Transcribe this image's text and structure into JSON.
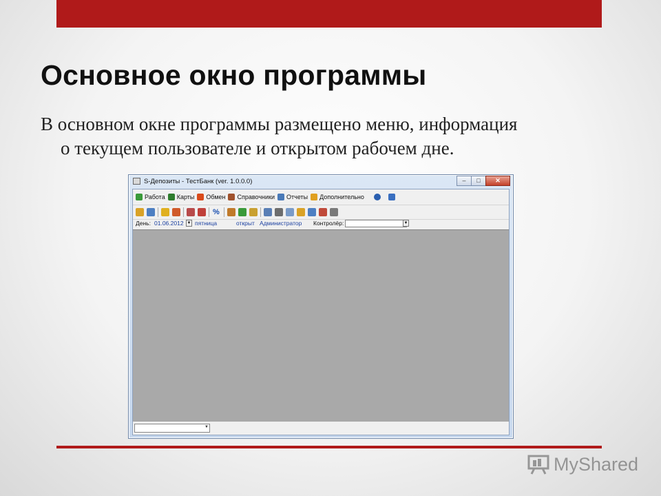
{
  "slide": {
    "title": "Основное окно программы",
    "body_line1": "В основном окне программы размещено меню, информация",
    "body_line2": "о текущем пользователе и открытом рабочем дне."
  },
  "colors": {
    "accent": "#b01a1a",
    "workspace": "#a9a9a9"
  },
  "window": {
    "title": "S-Депозиты - ТестБанк (ver. 1.0.0.0)",
    "menu": [
      {
        "label": "Работа",
        "icon": "work-icon",
        "color": "#3a9a3a"
      },
      {
        "label": "Карты",
        "icon": "cards-icon",
        "color": "#2e7d2e"
      },
      {
        "label": "Обмен",
        "icon": "exchange-icon",
        "color": "#d94a1a"
      },
      {
        "label": "Справочники",
        "icon": "books-icon",
        "color": "#a0522d"
      },
      {
        "label": "Отчеты",
        "icon": "reports-icon",
        "color": "#4a7ab8"
      },
      {
        "label": "Дополнительно",
        "icon": "extra-icon",
        "color": "#e0a020"
      }
    ],
    "toolbar_pct": "%",
    "day": {
      "label": "День:",
      "date": "01.06.2012",
      "weekday": "пятница",
      "status": "открыт",
      "user": "Администратор",
      "controller_label": "Контролёр:"
    }
  },
  "watermark": {
    "text": "MyShared"
  }
}
